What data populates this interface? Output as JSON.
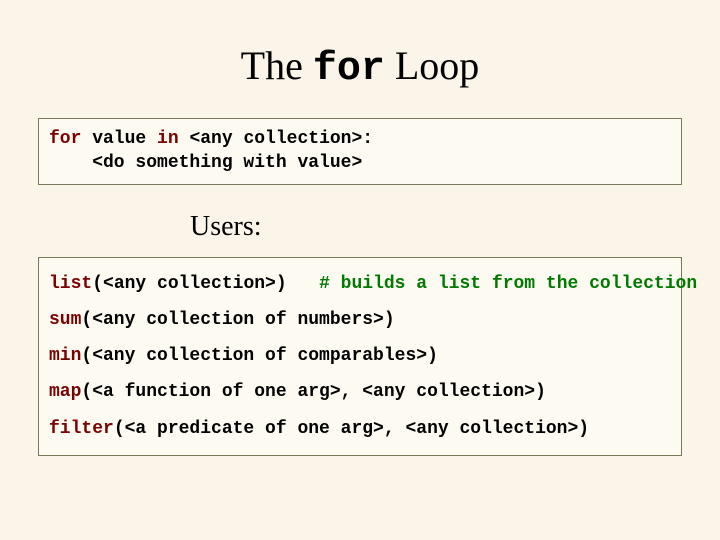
{
  "title": {
    "pre": "The ",
    "kw": "for",
    "post": " Loop"
  },
  "syntax": {
    "kw_for": "for",
    "var": " value ",
    "kw_in": "in",
    "coll": " <any collection>:",
    "indent": "    <do something with value>"
  },
  "subheading": "Users:",
  "users": {
    "list": {
      "fn": "list",
      "args": "(<any collection>)   ",
      "comment": "# builds a list from the collection"
    },
    "sum": {
      "fn": "sum",
      "args": "(<any collection of numbers>)"
    },
    "min": {
      "fn": "min",
      "args": "(<any collection of comparables>)"
    },
    "map": {
      "fn": "map",
      "args": "(<a function of one arg>, <any collection>)"
    },
    "filter": {
      "fn": "filter",
      "args": "(<a predicate of one arg>, <any collection>)"
    }
  }
}
